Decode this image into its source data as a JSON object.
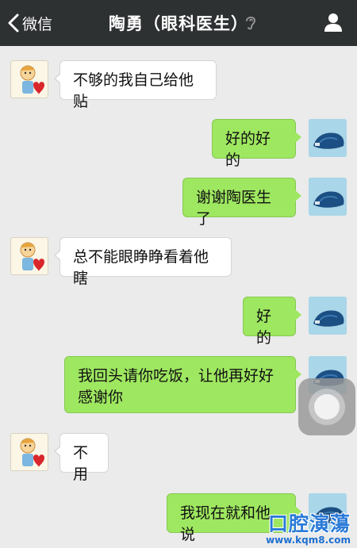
{
  "nav": {
    "back_label": "微信",
    "title": "陶勇（眼科医生）"
  },
  "messages": [
    {
      "side": "left",
      "text": "不够的我自己给他贴"
    },
    {
      "side": "right",
      "text": "好的好的"
    },
    {
      "side": "right",
      "text": "谢谢陶医生了"
    },
    {
      "side": "left",
      "text": "总不能眼睁睁看着他瞎"
    },
    {
      "side": "right",
      "text": "好的"
    },
    {
      "side": "right",
      "text": "我回头请你吃饭，让他再好好感谢你"
    },
    {
      "side": "left",
      "text": "不用"
    },
    {
      "side": "right",
      "text": "我现在就和他说"
    }
  ],
  "watermark": {
    "main": "口腔演蕩",
    "url": "www.kqm8.com"
  },
  "colors": {
    "nav_bg": "#2e3132",
    "chat_bg": "#ebebeb",
    "bubble_right": "#9ee760",
    "bubble_left": "#ffffff"
  }
}
